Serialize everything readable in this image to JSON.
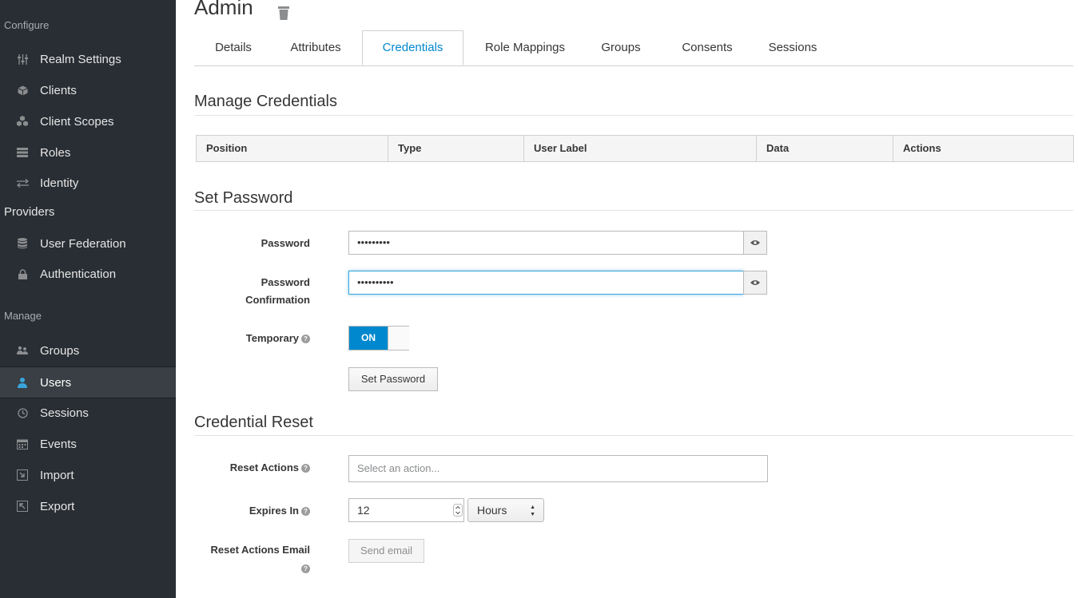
{
  "sidebar": {
    "configure_label": "Configure",
    "manage_label": "Manage",
    "configure_items": [
      {
        "label": "Realm Settings",
        "icon": "sliders-icon"
      },
      {
        "label": "Clients",
        "icon": "cube-icon"
      },
      {
        "label": "Client Scopes",
        "icon": "cubes-icon"
      },
      {
        "label": "Roles",
        "icon": "list-icon"
      },
      {
        "label": "Identity",
        "label2": "Providers",
        "icon": "exchange-icon"
      },
      {
        "label": "User Federation",
        "icon": "database-icon"
      },
      {
        "label": "Authentication",
        "icon": "lock-icon"
      }
    ],
    "manage_items": [
      {
        "label": "Groups",
        "icon": "users-icon"
      },
      {
        "label": "Users",
        "icon": "user-icon",
        "active": true
      },
      {
        "label": "Sessions",
        "icon": "clock-icon"
      },
      {
        "label": "Events",
        "icon": "calendar-icon"
      },
      {
        "label": "Import",
        "icon": "import-icon"
      },
      {
        "label": "Export",
        "icon": "export-icon"
      }
    ]
  },
  "header": {
    "title": "Admin"
  },
  "tabs": [
    {
      "label": "Details"
    },
    {
      "label": "Attributes"
    },
    {
      "label": "Credentials",
      "active": true
    },
    {
      "label": "Role Mappings"
    },
    {
      "label": "Groups"
    },
    {
      "label": "Consents"
    },
    {
      "label": "Sessions"
    }
  ],
  "manage_credentials": {
    "title": "Manage Credentials",
    "columns": [
      "Position",
      "Type",
      "User Label",
      "Data",
      "Actions"
    ]
  },
  "set_password": {
    "title": "Set Password",
    "password_label": "Password",
    "password_value": "•••••••••",
    "confirm_label_1": "Password",
    "confirm_label_2": "Confirmation",
    "confirm_value": "••••••••••",
    "temporary_label": "Temporary",
    "temporary_state": "ON",
    "button_label": "Set Password"
  },
  "credential_reset": {
    "title": "Credential Reset",
    "reset_actions_label": "Reset Actions",
    "reset_actions_placeholder": "Select an action...",
    "expires_label": "Expires In",
    "expires_value": "12",
    "expires_unit": "Hours",
    "email_label": "Reset Actions Email",
    "email_button": "Send email"
  },
  "colors": {
    "accent": "#0088ce",
    "sidebar_bg": "#292e34"
  }
}
